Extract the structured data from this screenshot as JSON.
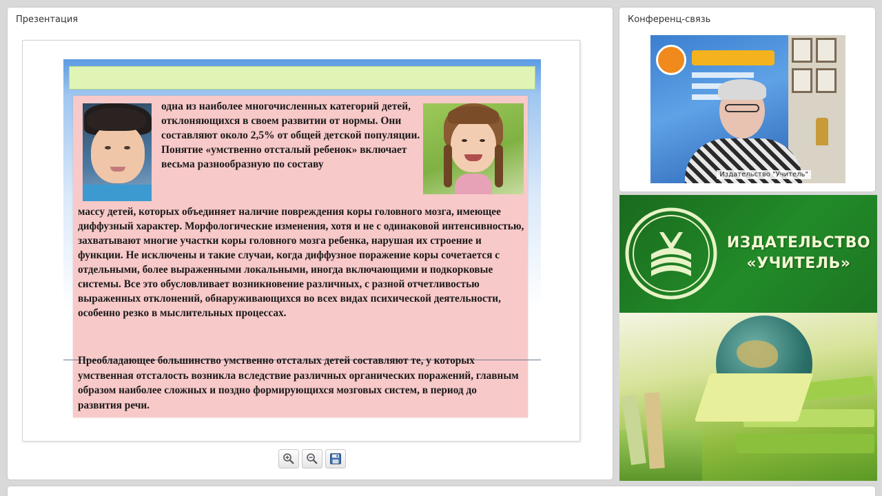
{
  "presentation": {
    "title": "Презентация",
    "slide": {
      "paragraph_top": "одна из наиболее многочисленных категорий детей, отклоняющихся в своем развитии от нормы. Они составляют около 2,5% от общей детской популяции. Понятие «умственно отсталый ребенок» включает весьма разнообразную по составу",
      "paragraph_wide": "массу детей, которых объединяет наличие повреждения коры головного мозга, имеющее диффузный характер. Морфологические изменения, хотя и не с одинаковой интенсивностью, захватывают многие участки коры головного мозга ребенка, нарушая их строение и функции. Не исключены и такие случаи, когда диффузное поражение коры сочетается с отдельными, более выраженными локальными, иногда включающими и подкорковые системы. Все это обусловливает возникновение различных, с разной отчетливостью выраженных отклонений, обнаруживающихся во всех видах психической деятельности, особенно резко в мыслительных процессах.",
      "paragraph_bottom": "Преобладающее большинство умственно отсталых детей составляют те, у которых умственная отсталость возникла вследствие различных органических поражений, главным образом наиболее сложных и поздно формирующихся мозговых систем, в период до развития речи."
    },
    "tools": [
      {
        "name": "zoom-in-icon"
      },
      {
        "name": "zoom-out-icon"
      },
      {
        "name": "save-icon"
      }
    ]
  },
  "conference": {
    "title": "Конференц-связь",
    "video_caption": "Издательство \"Учитель\""
  },
  "banner": {
    "line1": "ИЗДАТЕЛЬСТВО",
    "line2": "«УЧИТЕЛЬ»"
  },
  "colors": {
    "accent_green": "#228b28",
    "slide_pink": "#f8c9c9",
    "slide_topbar": "#dff4b5"
  }
}
